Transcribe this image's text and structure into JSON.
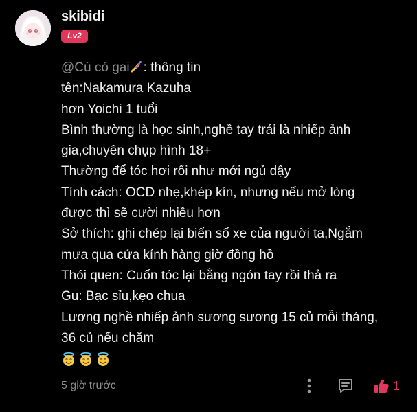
{
  "user": {
    "name": "skibidi",
    "level": "Lv2"
  },
  "comment": {
    "mention": "@Cú có gai",
    "mention_emoji": "writing-hand-emoji",
    "lines": [
      ": thông tin",
      "tên:Nakamura Kazuha",
      "hơn Yoichi 1 tuổi",
      "Bình thường là học sinh,nghề tay trái là nhiếp ảnh",
      "gia,chuyên chụp hình 18+",
      "Thường để tóc hơi rối như mới ngủ dậy",
      "Tính cách: OCD nhẹ,khép kín, nhưng nếu mở lòng",
      "được thì sẽ cười nhiều hơn",
      "Sở thích: ghi chép lại biển số xe của người ta,Ngắm",
      "mưa qua cửa kính hàng giờ đồng hồ",
      "Thói quen: Cuốn tóc lại bằng ngón tay rồi thả ra",
      "Gu: Bạc sỉu,kẹo chua",
      "Lương nghề nhiếp ảnh sương sương 15 củ mỗi tháng,",
      "36 củ nếu chăm"
    ],
    "trailing_emojis": [
      "smiling-face-with-halo",
      "smiling-face-with-halo",
      "smiling-face-with-halo"
    ]
  },
  "footer": {
    "timestamp": "5 giờ trước",
    "like_count": "1",
    "icons": [
      "more-vertical-icon",
      "reply-icon",
      "thumbs-up-icon"
    ]
  },
  "colors": {
    "background": "#000000",
    "text": "#f0f0f0",
    "muted": "#8c8c8c",
    "accent": "#e0375a"
  }
}
